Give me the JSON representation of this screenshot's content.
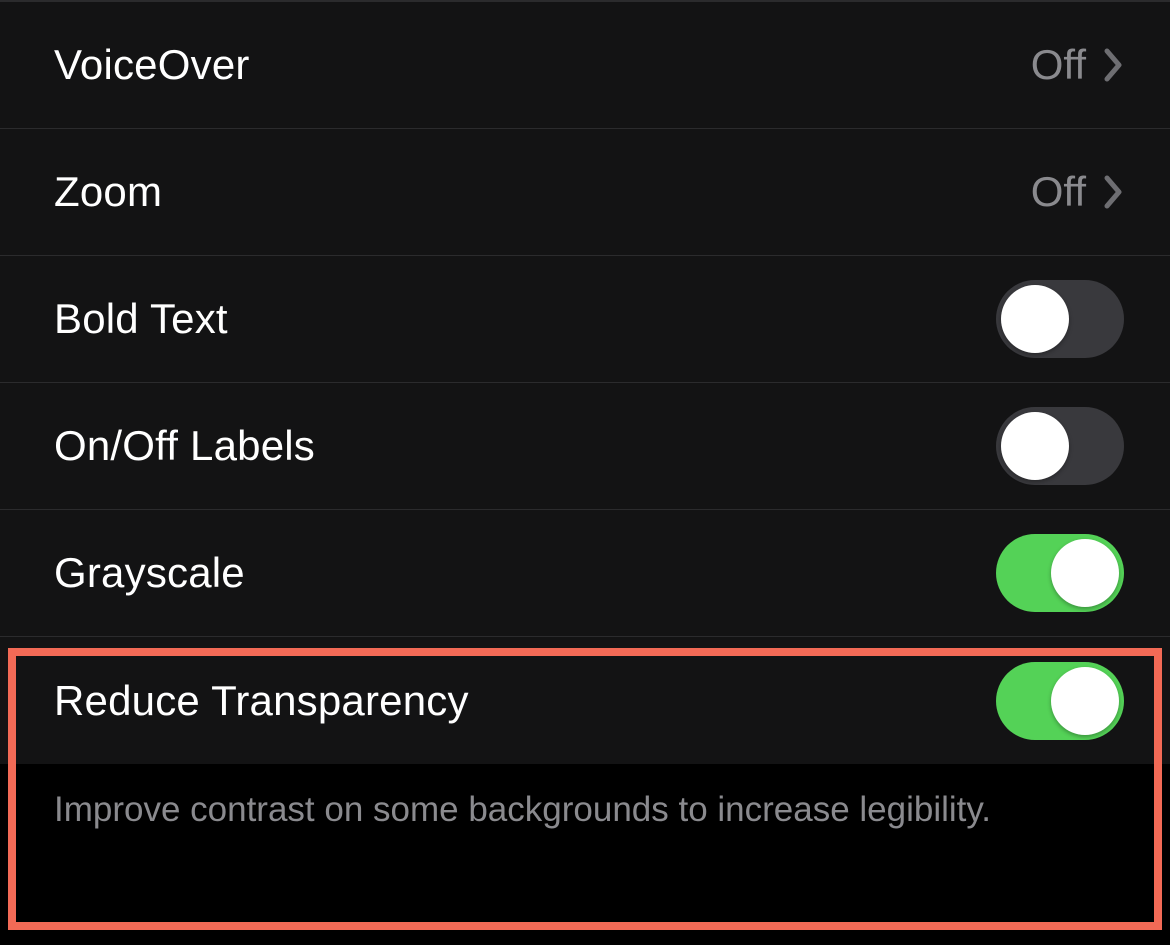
{
  "settings": {
    "items": [
      {
        "key": "voiceover",
        "label": "VoiceOver",
        "type": "nav",
        "value": "Off"
      },
      {
        "key": "zoom",
        "label": "Zoom",
        "type": "nav",
        "value": "Off"
      },
      {
        "key": "bold_text",
        "label": "Bold Text",
        "type": "switch",
        "on": false
      },
      {
        "key": "onoff_labels",
        "label": "On/Off Labels",
        "type": "switch",
        "on": false
      },
      {
        "key": "grayscale",
        "label": "Grayscale",
        "type": "switch",
        "on": true
      },
      {
        "key": "reduce_transparency",
        "label": "Reduce Transparency",
        "type": "switch",
        "on": true
      }
    ],
    "footer": "Improve contrast on some backgrounds to increase legibility."
  },
  "colors": {
    "accent_green": "#54d257",
    "highlight": "#f26a56"
  }
}
